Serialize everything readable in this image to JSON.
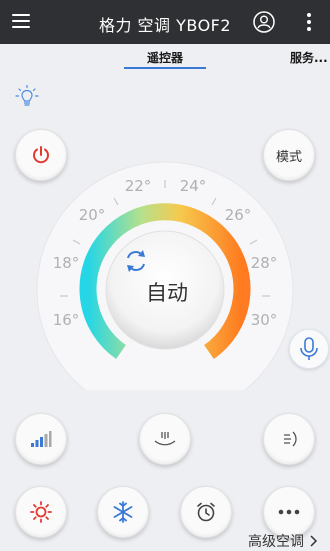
{
  "header": {
    "title": "格力 空调 YBOF2"
  },
  "tabs": [
    {
      "label": "遥控器"
    },
    {
      "label": "服务..."
    }
  ],
  "controls": {
    "mode_label": "模式"
  },
  "dial": {
    "mode_text": "自动",
    "ticks": [
      "16°",
      "18°",
      "20°",
      "22°",
      "24°",
      "26°",
      "28°",
      "30°"
    ]
  },
  "footer": {
    "advanced_label": "高级空调"
  },
  "colors": {
    "power_red": "#e3392f",
    "accent_blue": "#3a7ad6",
    "gradient": [
      "#25d6e6",
      "#b7e08a",
      "#f6c94d",
      "#ff8f2a"
    ]
  },
  "icons": [
    "menu-icon",
    "user-icon",
    "more-vertical-icon",
    "bulb-icon",
    "power-icon",
    "refresh-icon",
    "microphone-icon",
    "signal-strength-icon",
    "swing-vertical-icon",
    "swing-horizontal-icon",
    "sun-icon",
    "snowflake-icon",
    "alarm-clock-icon",
    "more-horizontal-icon",
    "chevron-right-icon"
  ]
}
